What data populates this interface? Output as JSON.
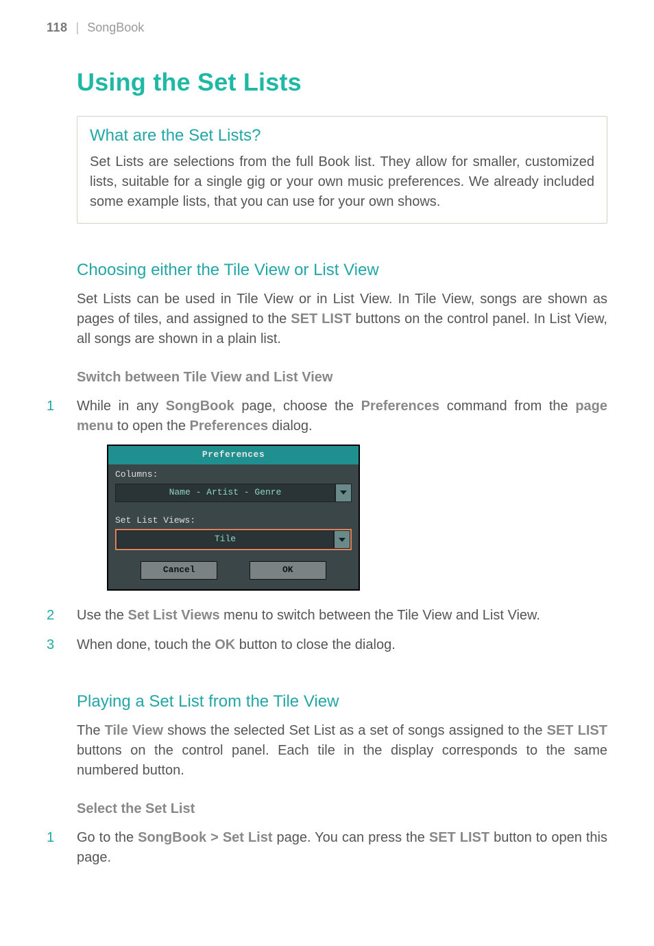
{
  "header": {
    "page_number": "118",
    "divider": "|",
    "section_name": "SongBook"
  },
  "title": "Using the Set Lists",
  "callout": {
    "heading": "What are the Set Lists?",
    "body": "Set Lists are selections from the full Book list. They allow for smaller, customized lists, suitable for a single gig or your own music preferences. We already included some example lists, that you can use for your own shows."
  },
  "s1": {
    "heading": "Choosing either the Tile View or List View",
    "intro_pre": "Set Lists can be used in Tile View or in List View. In Tile View, songs are shown as pages of tiles, and assigned to the ",
    "intro_sb1": "SET LIST",
    "intro_post": " buttons on the control panel. In List View, all songs are shown in a plain list.",
    "subhead": "Switch between Tile View and List View",
    "step1_a": "While in any ",
    "step1_b": "SongBook",
    "step1_c": " page, choose the ",
    "step1_d": "Preferences",
    "step1_e": " command from the ",
    "step1_f": "page menu",
    "step1_g": " to open the ",
    "step1_h": "Preferences",
    "step1_i": " dialog.",
    "step2_a": "Use the ",
    "step2_b": "Set List Views",
    "step2_c": " menu to switch between the Tile View and List View.",
    "step3_a": "When done, touch the ",
    "step3_b": "OK",
    "step3_c": " button to close the dialog."
  },
  "dialog": {
    "title": "Preferences",
    "columns_label": "Columns:",
    "columns_value": "Name - Artist - Genre",
    "setlist_label": "Set List Views:",
    "setlist_value": "Tile",
    "cancel": "Cancel",
    "ok": "OK"
  },
  "s2": {
    "heading": "Playing a Set List from the Tile View",
    "intro_a": "The ",
    "intro_b": "Tile View",
    "intro_c": " shows the selected Set List as a set of songs assigned to the ",
    "intro_d": "SET LIST",
    "intro_e": " buttons on the control panel. Each tile in the display corresponds to the same numbered button.",
    "subhead": "Select the Set List",
    "step1_a": "Go to the ",
    "step1_b": "SongBook > Set List",
    "step1_c": " page. You can press the ",
    "step1_d": "SET LIST",
    "step1_e": " button to open this page."
  }
}
